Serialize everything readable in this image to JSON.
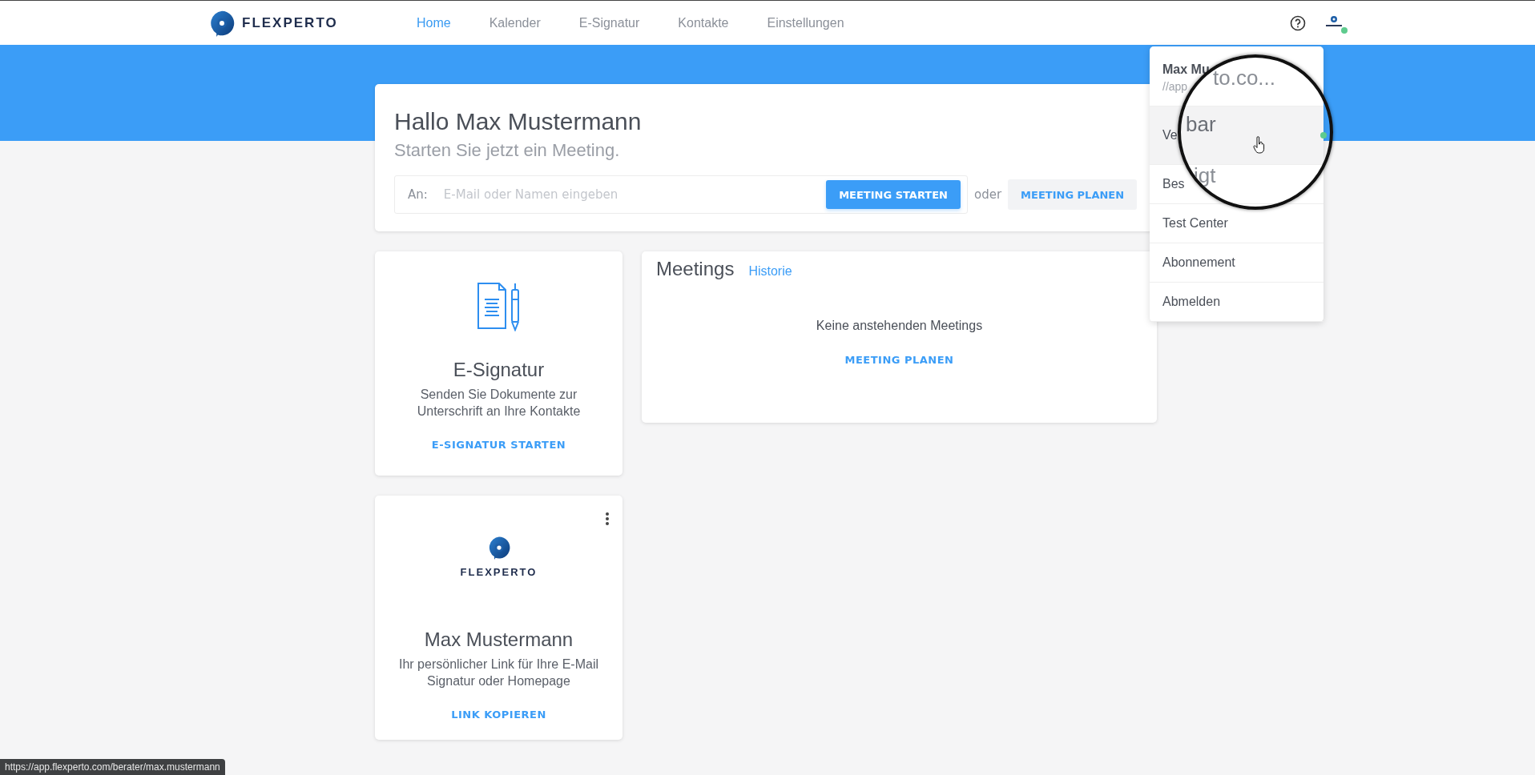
{
  "header": {
    "brand": "FLEXPERTO",
    "nav": [
      {
        "label": "Home",
        "selected": true
      },
      {
        "label": "Kalender",
        "selected": false
      },
      {
        "label": "E-Signatur",
        "selected": false
      },
      {
        "label": "Kontakte",
        "selected": false
      },
      {
        "label": "Einstellungen",
        "selected": false
      }
    ],
    "avatar": {
      "online": true
    }
  },
  "greeting": {
    "title": "Hallo Max Mustermann",
    "subtitle": "Starten Sie jetzt ein Meeting.",
    "to_label": "An:",
    "placeholder": "E-Mail oder Namen eingeben",
    "start_button": "MEETING STARTEN",
    "or": "oder",
    "plan_button": "MEETING PLANEN"
  },
  "esign_card": {
    "title": "E-Signatur",
    "text": "Senden Sie Dokumente zur Unterschrift an Ihre Kontakte",
    "action": "E-SIGNATUR STARTEN"
  },
  "meetings_card": {
    "title": "Meetings",
    "history_link": "Historie",
    "empty_text": "Keine anstehenden Meetings",
    "action": "MEETING PLANEN"
  },
  "profile_card": {
    "brand": "FLEXPERTO",
    "name": "Max Mustermann",
    "text": "Ihr persönlicher Link für Ihre E-Mail Signatur oder Homepage",
    "action": "LINK KOPIEREN"
  },
  "user_menu": {
    "name": "Max Mu",
    "url": "//app",
    "items": [
      {
        "label": "Ve",
        "hovered": true,
        "online": true
      },
      {
        "label": "Bes",
        "hovered": false,
        "online": false
      },
      {
        "label": "Test Center",
        "hovered": false,
        "online": false
      },
      {
        "label": "Abonnement",
        "hovered": false,
        "online": false
      },
      {
        "label": "Abmelden",
        "hovered": false,
        "online": false
      }
    ],
    "magnifier": {
      "texts": [
        "to.co...",
        "bar",
        "igt"
      ]
    }
  },
  "status_bar": {
    "url": "https://app.flexperto.com/berater/max.mustermann"
  }
}
